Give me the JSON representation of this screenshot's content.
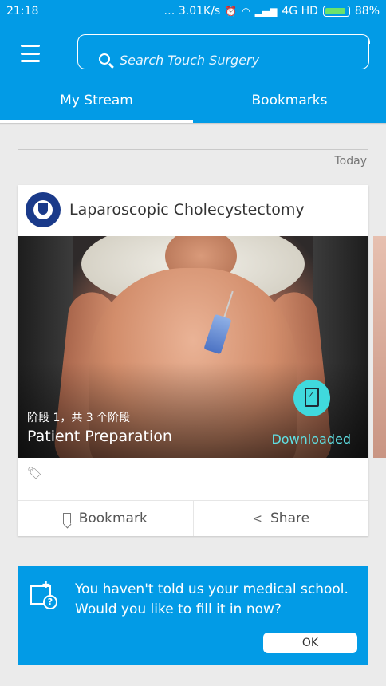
{
  "status_bar": {
    "time": "21:18",
    "right_text": "… 3.01K/s",
    "network": "4G HD",
    "battery": "88%",
    "icons": [
      "alarm-icon",
      "wifi-icon",
      "signal-icon",
      "battery-icon"
    ]
  },
  "app_bar": {
    "search_placeholder": "Search Touch Surgery",
    "tabs": [
      {
        "label": "My Stream",
        "active": true
      },
      {
        "label": "Bookmarks",
        "active": false
      }
    ]
  },
  "feed": {
    "date_label": "Today",
    "card": {
      "title": "Laparoscopic Cholecystectomy",
      "stage_label": "阶段 1，共 3 个阶段",
      "stage_name": "Patient Preparation",
      "status": "Downloaded",
      "actions": {
        "bookmark": "Bookmark",
        "share": "Share"
      }
    }
  },
  "banner": {
    "message": "You haven't told us your medical school. Would you like to fill it in now?",
    "ok_label": "OK"
  },
  "colors": {
    "primary": "#029be6",
    "downloaded": "#5fe0e4",
    "badge": "#40d9dd"
  }
}
